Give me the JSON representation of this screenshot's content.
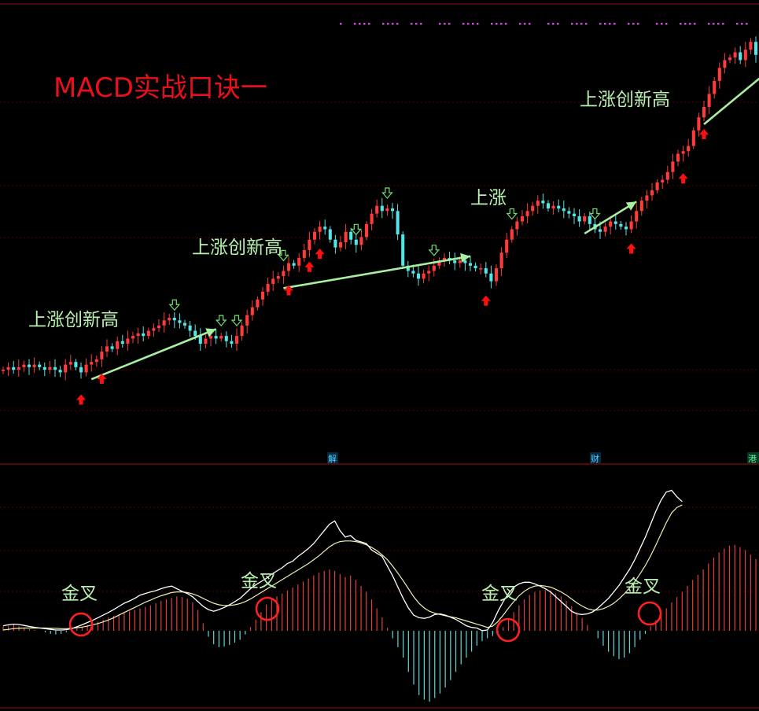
{
  "title": "MACD实战口诀一",
  "colors": {
    "background": "#000000",
    "up_candle": "#ff3b3b",
    "down_candle": "#54e6e6",
    "grid": "#5a0000",
    "arrow_line": "#a8f0a0",
    "annotation_text": "#b8f0b0",
    "title": "#e8101a",
    "buy_marker": "#ff1010",
    "circle": "#ff2020",
    "macd_dif": "#ffffff",
    "macd_dea": "#f0f0b0",
    "marker_purple": "#c050d0"
  },
  "annotations": {
    "rise_1": "上涨创新高",
    "rise_2": "上涨创新高",
    "rise_3": "上涨",
    "rise_4": "上涨创新高",
    "cross_1": "金叉",
    "cross_2": "金叉",
    "cross_3": "金叉",
    "cross_4": "金叉"
  },
  "event_labels": [
    "解",
    "财",
    "港"
  ],
  "chart_data": [
    {
      "type": "candlestick",
      "title": "MACD实战口诀一",
      "closes": [
        8.6,
        8.7,
        8.6,
        8.7,
        8.8,
        8.7,
        8.8,
        8.7,
        8.6,
        8.7,
        8.6,
        8.5,
        8.8,
        8.9,
        8.7,
        8.5,
        8.8,
        8.9,
        9.0,
        9.3,
        9.5,
        9.4,
        9.7,
        9.6,
        9.8,
        9.9,
        10.0,
        9.9,
        10.1,
        10.2,
        10.3,
        10.5,
        10.6,
        10.5,
        10.4,
        10.3,
        10.1,
        9.9,
        9.6,
        9.8,
        9.9,
        9.8,
        9.9,
        9.7,
        9.6,
        9.9,
        10.3,
        10.7,
        11.0,
        11.3,
        11.6,
        11.9,
        12.1,
        12.2,
        12.4,
        12.7,
        12.6,
        12.9,
        13.2,
        13.6,
        13.9,
        14.1,
        14.0,
        13.6,
        13.3,
        13.5,
        13.9,
        13.6,
        13.4,
        13.7,
        14.2,
        14.6,
        14.9,
        14.7,
        14.8,
        14.7,
        13.8,
        12.6,
        12.4,
        12.3,
        12.1,
        12.3,
        12.4,
        12.6,
        12.8,
        12.9,
        12.8,
        12.7,
        12.8,
        12.7,
        12.6,
        12.5,
        12.5,
        12.3,
        12.0,
        12.5,
        13.1,
        13.6,
        14.0,
        14.3,
        14.5,
        14.7,
        14.9,
        15.1,
        15.0,
        14.8,
        14.9,
        14.8,
        14.7,
        14.6,
        14.5,
        14.3,
        14.5,
        14.2,
        14.0,
        13.9,
        14.1,
        14.3,
        14.2,
        14.1,
        14.0,
        14.3,
        14.7,
        15.1,
        15.3,
        15.5,
        15.8,
        15.9,
        16.2,
        16.6,
        16.9,
        17.0,
        17.2,
        17.8,
        18.3,
        18.7,
        19.2,
        19.7,
        20.2,
        20.5,
        20.6,
        20.8,
        20.5,
        20.9,
        21.2,
        20.7
      ],
      "buy_marker_indices": [
        15,
        19,
        55,
        59,
        61,
        93,
        121,
        131,
        135
      ],
      "sell_marker_indices": [
        33,
        42,
        45,
        54,
        68,
        74,
        83,
        98,
        114
      ],
      "trend_segments": [
        [
          17,
          41
        ],
        [
          54,
          90
        ],
        [
          112,
          122
        ],
        [
          135,
          164
        ]
      ],
      "xlabel": "",
      "ylabel": ""
    },
    {
      "type": "macd",
      "histogram": [
        0.06,
        0.07,
        0.08,
        0.06,
        0.04,
        0.02,
        0.01,
        0.0,
        -0.02,
        -0.04,
        -0.05,
        -0.04,
        -0.02,
        0.0,
        0.03,
        0.05,
        0.08,
        0.1,
        0.12,
        0.15,
        0.18,
        0.2,
        0.22,
        0.24,
        0.26,
        0.28,
        0.3,
        0.32,
        0.34,
        0.37,
        0.4,
        0.42,
        0.44,
        0.46,
        0.45,
        0.43,
        0.38,
        0.28,
        0.1,
        -0.08,
        -0.18,
        -0.22,
        -0.21,
        -0.19,
        -0.16,
        -0.12,
        -0.05,
        0.05,
        0.15,
        0.25,
        0.35,
        0.42,
        0.46,
        0.5,
        0.54,
        0.58,
        0.62,
        0.66,
        0.7,
        0.74,
        0.78,
        0.8,
        0.82,
        0.8,
        0.76,
        0.72,
        0.74,
        0.68,
        0.6,
        0.52,
        0.42,
        0.3,
        0.18,
        0.04,
        -0.1,
        -0.22,
        -0.36,
        -0.55,
        -0.72,
        -0.86,
        -0.92,
        -0.95,
        -0.9,
        -0.84,
        -0.76,
        -0.66,
        -0.55,
        -0.45,
        -0.36,
        -0.28,
        -0.2,
        -0.14,
        -0.1,
        -0.07,
        -0.02,
        0.05,
        0.15,
        0.25,
        0.34,
        0.42,
        0.48,
        0.52,
        0.54,
        0.55,
        0.54,
        0.5,
        0.46,
        0.4,
        0.33,
        0.25,
        0.17,
        0.08,
        0.0,
        -0.1,
        -0.2,
        -0.28,
        -0.34,
        -0.38,
        -0.36,
        -0.3,
        -0.22,
        -0.12,
        -0.04,
        0.06,
        0.14,
        0.22,
        0.3,
        0.38,
        0.45,
        0.52,
        0.6,
        0.68,
        0.75,
        0.82,
        0.9,
        0.98,
        1.05,
        1.1,
        1.14,
        1.15,
        1.12,
        1.08,
        1.02,
        0.96
      ],
      "dif": [
        0.35,
        0.38,
        0.4,
        0.39,
        0.36,
        0.33,
        0.3,
        0.28,
        0.26,
        0.24,
        0.22,
        0.22,
        0.23,
        0.26,
        0.32,
        0.38,
        0.45,
        0.52,
        0.6,
        0.68,
        0.76,
        0.85,
        0.95,
        1.05,
        1.12,
        1.2,
        1.3,
        1.35,
        1.4,
        1.44,
        1.5,
        1.55,
        1.58,
        1.5,
        1.42,
        1.35,
        1.25,
        1.1,
        0.95,
        0.85,
        0.8,
        0.85,
        0.92,
        1.0,
        1.1,
        1.2,
        1.35,
        1.5,
        1.62,
        1.72,
        1.82,
        1.95,
        2.05,
        2.15,
        2.28,
        2.35,
        2.5,
        2.62,
        2.75,
        2.9,
        3.1,
        3.3,
        3.5,
        3.6,
        3.3,
        3.1,
        3.15,
        3.0,
        2.95,
        2.9,
        2.7,
        2.6,
        2.5,
        2.2,
        1.9,
        1.55,
        1.2,
        0.9,
        0.68,
        0.6,
        0.58,
        0.62,
        0.7,
        0.72,
        0.68,
        0.62,
        0.55,
        0.45,
        0.35,
        0.3,
        0.28,
        0.2,
        0.22,
        0.45,
        0.8,
        1.1,
        1.35,
        1.55,
        1.65,
        1.7,
        1.7,
        1.65,
        1.58,
        1.5,
        1.4,
        1.25,
        1.1,
        0.95,
        0.8,
        0.72,
        0.7,
        0.72,
        0.78,
        0.9,
        1.05,
        1.2,
        1.4,
        1.6,
        1.85,
        2.1,
        2.4,
        2.75,
        3.1,
        3.5,
        3.9,
        4.25,
        4.5,
        4.55,
        4.35,
        4.2
      ],
      "dea": [
        0.22,
        0.24,
        0.26,
        0.27,
        0.28,
        0.28,
        0.28,
        0.28,
        0.28,
        0.27,
        0.27,
        0.26,
        0.26,
        0.27,
        0.29,
        0.31,
        0.34,
        0.38,
        0.42,
        0.47,
        0.53,
        0.6,
        0.68,
        0.76,
        0.84,
        0.92,
        1.0,
        1.08,
        1.15,
        1.22,
        1.28,
        1.33,
        1.38,
        1.4,
        1.4,
        1.38,
        1.34,
        1.28,
        1.2,
        1.12,
        1.05,
        1.0,
        0.98,
        0.98,
        1.0,
        1.04,
        1.1,
        1.18,
        1.28,
        1.38,
        1.48,
        1.58,
        1.68,
        1.78,
        1.88,
        1.98,
        2.08,
        2.18,
        2.28,
        2.4,
        2.52,
        2.66,
        2.8,
        2.9,
        2.96,
        2.98,
        2.98,
        2.96,
        2.92,
        2.86,
        2.78,
        2.68,
        2.55,
        2.4,
        2.2,
        1.98,
        1.75,
        1.5,
        1.25,
        1.05,
        0.9,
        0.8,
        0.74,
        0.7,
        0.66,
        0.63,
        0.6,
        0.55,
        0.5,
        0.45,
        0.4,
        0.35,
        0.3,
        0.34,
        0.48,
        0.68,
        0.9,
        1.1,
        1.28,
        1.42,
        1.52,
        1.58,
        1.6,
        1.58,
        1.55,
        1.48,
        1.4,
        1.3,
        1.18,
        1.06,
        0.96,
        0.88,
        0.84,
        0.84,
        0.88,
        0.95,
        1.05,
        1.18,
        1.34,
        1.52,
        1.72,
        1.96,
        2.22,
        2.52,
        2.85,
        3.2,
        3.55,
        3.85,
        4.02,
        4.1
      ],
      "xlabel": "",
      "ylabel": ""
    }
  ]
}
